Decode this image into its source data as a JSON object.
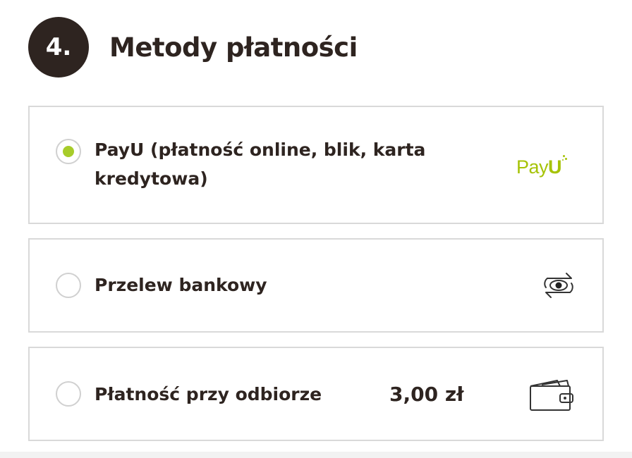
{
  "header": {
    "step_number": "4.",
    "title": "Metody płatności"
  },
  "payment_methods": [
    {
      "label": "PayU (płatność online, blik, karta kredytowa)",
      "selected": true,
      "logo_text": "PayU",
      "icon": "payu-logo"
    },
    {
      "label": "Przelew bankowy",
      "selected": false,
      "icon": "bank-transfer-icon"
    },
    {
      "label": "Płatność przy odbiorze",
      "selected": false,
      "price": "3,00 zł",
      "icon": "wallet-icon"
    }
  ],
  "colors": {
    "text": "#2e2420",
    "badge_bg": "#2e2420",
    "accent": "#a7cc2a",
    "payu_green": "#a6c307",
    "border": "#d9d9d9"
  }
}
